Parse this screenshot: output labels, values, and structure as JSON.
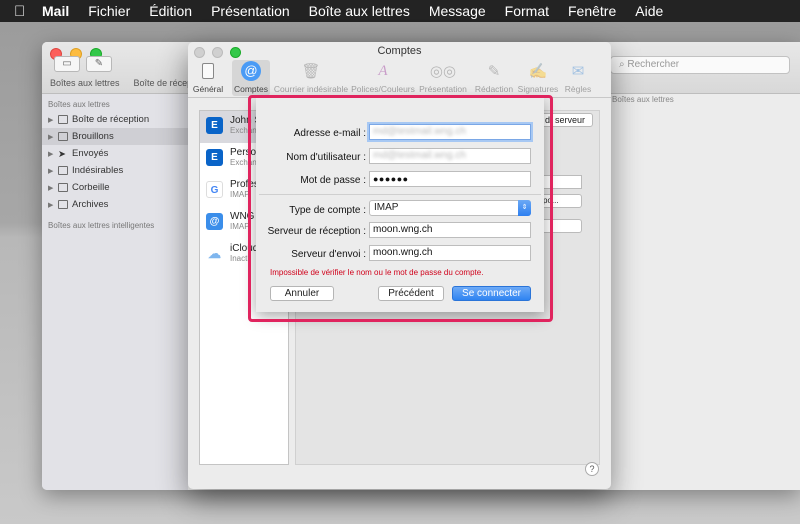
{
  "menubar": {
    "app": "Mail",
    "items": [
      "Fichier",
      "Édition",
      "Présentation",
      "Boîte aux lettres",
      "Message",
      "Format",
      "Fenêtre",
      "Aide"
    ]
  },
  "mail_window": {
    "favorites": [
      "Boîtes aux lettres",
      "Boîte de récep"
    ],
    "search_placeholder": "Rechercher",
    "list_header": "Boîtes aux lettres",
    "sidebar": {
      "section": "Boîtes aux lettres",
      "items": [
        {
          "label": "Boîte de réception"
        },
        {
          "label": "Brouillons"
        },
        {
          "label": "Envoyés"
        },
        {
          "label": "Indésirables"
        },
        {
          "label": "Corbeille"
        },
        {
          "label": "Archives"
        }
      ],
      "smart_section": "Boîtes aux lettres intelligentes"
    }
  },
  "prefs": {
    "title": "Comptes",
    "toolbar": [
      "Général",
      "Comptes",
      "Courrier indésirable",
      "Polices/Couleurs",
      "Présentation",
      "Rédaction",
      "Signatures",
      "Règles"
    ],
    "accounts": [
      {
        "name": "John S",
        "sub": "Exchan",
        "color": "#0a64c8",
        "glyph": "E"
      },
      {
        "name": "Persor",
        "sub": "Exchan",
        "color": "#0a64c8",
        "glyph": "E"
      },
      {
        "name": "Profes",
        "sub": "IMAP",
        "color": "#ffffff",
        "glyph": "G"
      },
      {
        "name": "WNG",
        "sub": "IMAP",
        "color": "#3b8eea",
        "glyph": "@"
      },
      {
        "name": "iCloud",
        "sub": "Inacti",
        "color": "#ffffff",
        "glyph": "☁"
      }
    ],
    "add_label": "+",
    "remove_label": "−",
    "server_button": "d. serveur",
    "dropdown_partial": "po...",
    "help": "?"
  },
  "dialog": {
    "email_label": "Adresse e-mail :",
    "email_value": "md@testmail.wng.ch",
    "username_label": "Nom d'utilisateur :",
    "username_value": "md@testmail.wng.ch",
    "password_label": "Mot de passe :",
    "password_value": "●●●●●●",
    "account_type_label": "Type de compte :",
    "account_type_value": "IMAP",
    "incoming_label": "Serveur de réception :",
    "incoming_value": "moon.wng.ch",
    "outgoing_label": "Serveur d'envoi :",
    "outgoing_value": "moon.wng.ch",
    "error": "Impossible de vérifier le nom ou le mot de passe du compte.",
    "cancel": "Annuler",
    "previous": "Précédent",
    "connect": "Se connecter"
  }
}
